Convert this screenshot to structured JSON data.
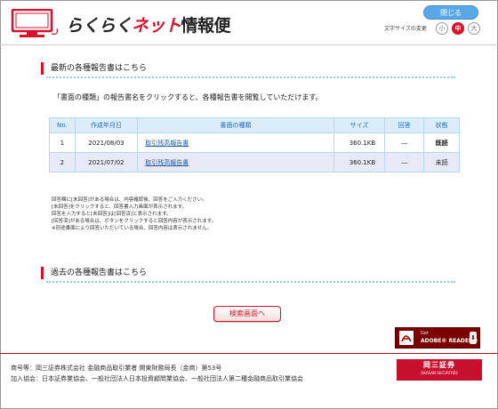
{
  "header": {
    "logo": {
      "part1": "らくらく",
      "part2": "ネット",
      "part3": "情報便"
    },
    "close_label": "閉じる",
    "font_size_label": "文字サイズの変更",
    "font_sizes": [
      "小",
      "中",
      "大"
    ],
    "font_size_selected": "中",
    "accent_color": "#d9112b",
    "button_color": "#5aa9e6"
  },
  "latest": {
    "title": "最新の各種報告書はこちら",
    "intro": "「書面の種類」の報告書名をクリックすると、各種報告書を閲覧していただけます。",
    "columns": [
      "No.",
      "作成年月日",
      "書面の種類",
      "サイズ",
      "回答",
      "状態"
    ],
    "rows": [
      {
        "no": "1",
        "date": "2021/08/03",
        "doc": "取引残高報告書",
        "size": "360.1KB",
        "answer": "―",
        "status": "既読"
      },
      {
        "no": "2",
        "date": "2021/07/02",
        "doc": "取引残高報告書",
        "size": "360.1KB",
        "answer": "―",
        "status": "未読"
      }
    ],
    "notes": [
      "回答欄に[未回答]がある場合は、内容確認後、回答をご入力ください。",
      "[未回答]をクリックすると、回答書入力画面が表示されます。",
      "回答を入力すると[未回答]は[回答済]と表示されます。",
      "[回答済]がある場合は、ボタンをクリックすると回答内容が表示されます。",
      "※別途書面により回答いただいている場合、回答内容は表示されません。"
    ]
  },
  "past": {
    "title": "過去の各種報告書はこちら",
    "search_label": "検索画面へ"
  },
  "adobe": {
    "get": "Get",
    "name": "ADOBE® READER®"
  },
  "footer": {
    "line1": "商号等：岡三証券株式会社 金融商品取引業者 関東財務局長（金商）第53号",
    "line2": "加入協会：日本証券業協会、一般社団法人日本投資顧問業協会、一般社団法人第二種金融商品取引業協会",
    "brand_jp": "岡三証券",
    "brand_en": "OKASAN SECURITIES",
    "brand_color": "#c8102e"
  }
}
